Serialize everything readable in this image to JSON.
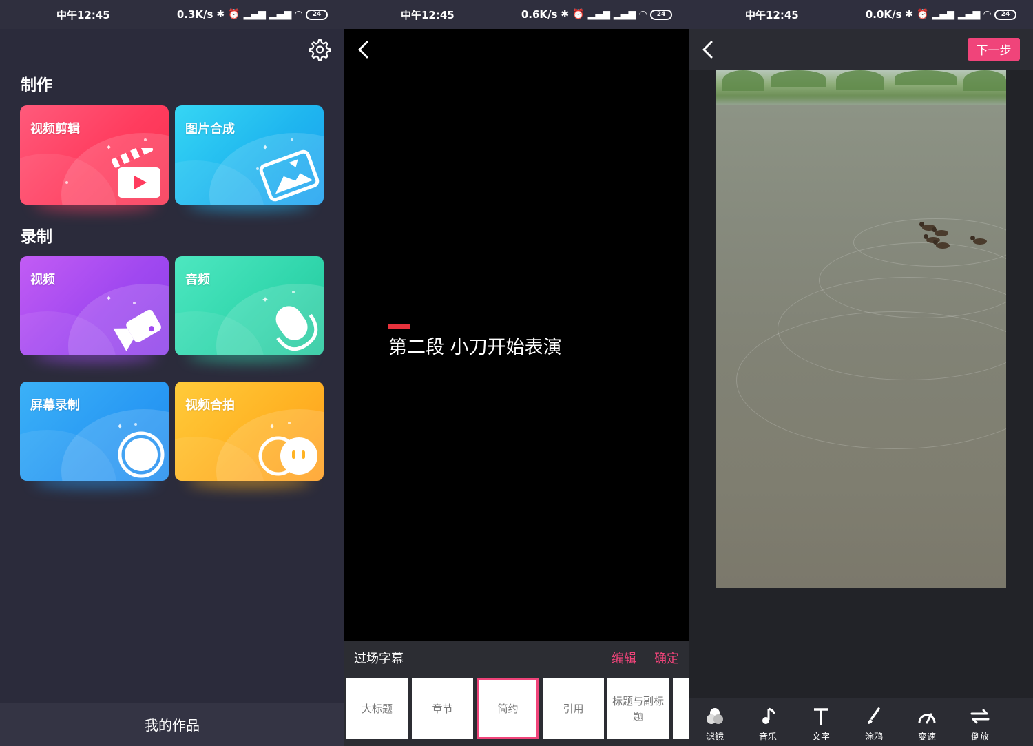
{
  "status_bars": [
    {
      "time": "中午12:45",
      "speed": "0.3K/s",
      "battery": "24"
    },
    {
      "time": "中午12:45",
      "speed": "0.6K/s",
      "battery": "24"
    },
    {
      "time": "中午12:45",
      "speed": "0.0K/s",
      "battery": "24"
    }
  ],
  "home": {
    "section_make": "制作",
    "section_record": "录制",
    "cards": {
      "video_edit": "视频剪辑",
      "photo_compose": "图片合成",
      "video": "视频",
      "audio": "音频",
      "screen_record": "屏幕录制",
      "video_duet": "视频合拍"
    },
    "my_works": "我的作品"
  },
  "subtitle_editor": {
    "caption": "第二段 小刀开始表演",
    "panel_title": "过场字幕",
    "edit": "编辑",
    "confirm": "确定",
    "templates": [
      "大标题",
      "章节",
      "简约",
      "引用",
      "标题与副标题"
    ],
    "selected_index": 2
  },
  "video_editor": {
    "next": "下一步",
    "tools": [
      "滤镜",
      "音乐",
      "文字",
      "涂鸦",
      "变速",
      "倒放"
    ]
  },
  "colors": {
    "accent": "#f0447a",
    "caption_mark": "#e7323c"
  }
}
